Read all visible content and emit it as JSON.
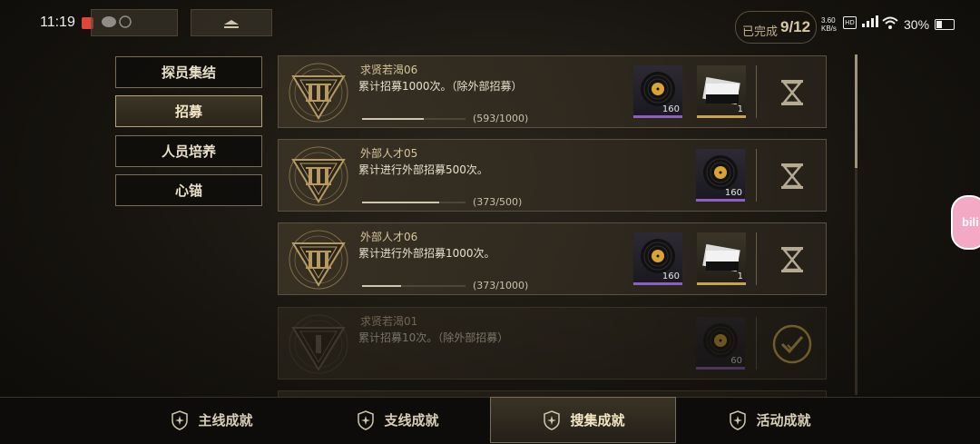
{
  "status_bar": {
    "time": "11:19",
    "network_speed": "3.60\nKB/s",
    "battery": "30%",
    "icons": [
      "app-notification-icon",
      "chat-icon",
      "hd-icon",
      "5g-signal-icon",
      "wifi-icon",
      "battery-icon"
    ]
  },
  "progress": {
    "label": "已完成",
    "value": "9/12"
  },
  "menu": {
    "items": [
      {
        "label": "探员集结",
        "active": false
      },
      {
        "label": "招募",
        "active": true
      },
      {
        "label": "人员培养",
        "active": false
      },
      {
        "label": "心锚",
        "active": false
      }
    ]
  },
  "achievements": [
    {
      "title": "求贤若渴06",
      "desc": "累计招募1000次。（除外部招募）",
      "count": "(593/1000)",
      "progress": 0.593,
      "rewards": [
        {
          "icon": "record-disc-icon",
          "qty": "160",
          "rarity": "purple"
        },
        {
          "icon": "ticket-card-icon",
          "qty": "1",
          "rarity": "gold"
        }
      ],
      "status": "in-progress"
    },
    {
      "title": "外部人才05",
      "desc": "累计进行外部招募500次。",
      "count": "(373/500)",
      "progress": 0.746,
      "rewards": [
        {
          "icon": "record-disc-icon",
          "qty": "160",
          "rarity": "purple"
        }
      ],
      "status": "in-progress"
    },
    {
      "title": "外部人才06",
      "desc": "累计进行外部招募1000次。",
      "count": "(373/1000)",
      "progress": 0.373,
      "rewards": [
        {
          "icon": "record-disc-icon",
          "qty": "160",
          "rarity": "purple"
        },
        {
          "icon": "ticket-card-icon",
          "qty": "1",
          "rarity": "gold"
        }
      ],
      "status": "in-progress"
    },
    {
      "title": "求贤若渴01",
      "desc": "累计招募10次。（除外部招募）",
      "count": "",
      "progress": 1,
      "rewards": [
        {
          "icon": "record-disc-icon",
          "qty": "60",
          "rarity": "purple"
        }
      ],
      "status": "completed"
    }
  ],
  "tabs": [
    {
      "label": "主线成就",
      "active": false
    },
    {
      "label": "支线成就",
      "active": false
    },
    {
      "label": "搜集成就",
      "active": true
    },
    {
      "label": "活动成就",
      "active": false
    }
  ],
  "side_float": {
    "label": "bili"
  },
  "colors": {
    "accent_gold": "#c9a54a",
    "rarity_purple": "#8e5fc2",
    "text": "#e8dfc8"
  }
}
